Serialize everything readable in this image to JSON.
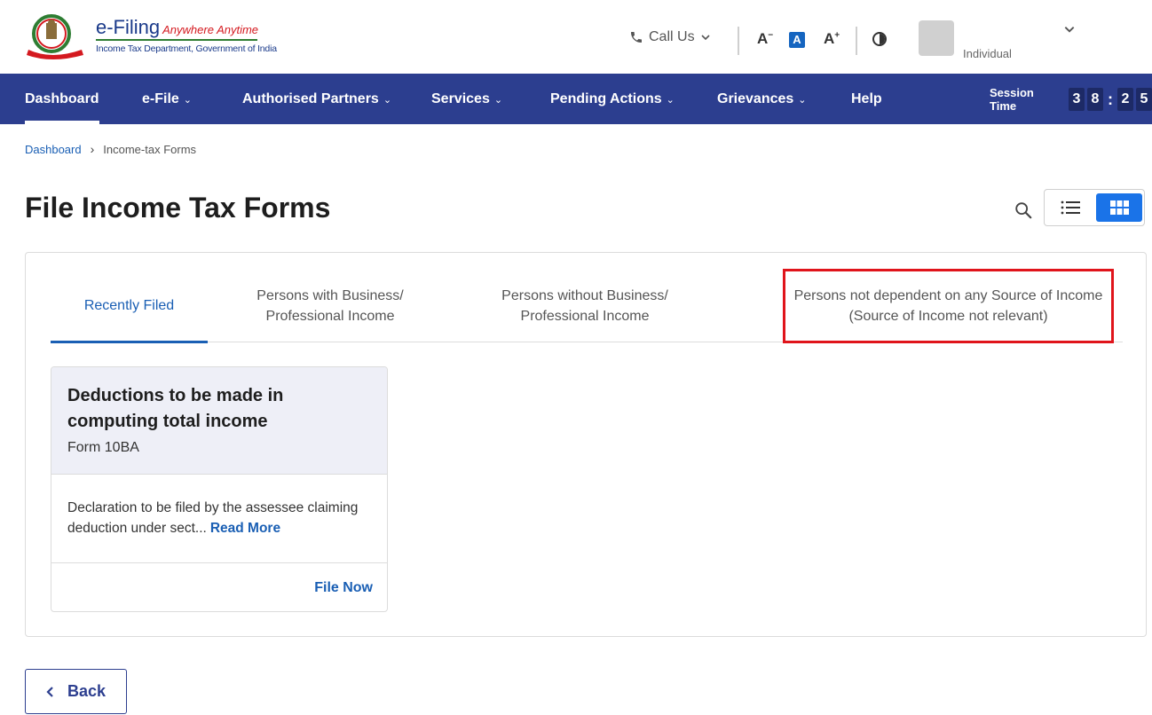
{
  "header": {
    "brand": "e-Filing",
    "tagline": "Anywhere Anytime",
    "department": "Income Tax Department, Government of India",
    "call_us": "Call Us",
    "font_decrease": "A",
    "font_normal": "A",
    "font_increase": "A",
    "user_type": "Individual"
  },
  "nav": {
    "items": [
      {
        "label": "Dashboard"
      },
      {
        "label": "e-File"
      },
      {
        "label": "Authorised Partners"
      },
      {
        "label": "Services"
      },
      {
        "label": "Pending Actions"
      },
      {
        "label": "Grievances"
      },
      {
        "label": "Help"
      }
    ],
    "session_label": "Session Time",
    "session_digits": [
      "3",
      "8",
      ":",
      "2",
      "5"
    ]
  },
  "breadcrumb": {
    "home": "Dashboard",
    "current": "Income-tax Forms"
  },
  "page": {
    "title": "File Income Tax Forms"
  },
  "tabs": [
    {
      "line1": "Recently Filed",
      "line2": ""
    },
    {
      "line1": "Persons with Business/",
      "line2": "Professional Income"
    },
    {
      "line1": "Persons without Business/",
      "line2": "Professional Income"
    },
    {
      "line1": "Persons not dependent on any Source of Income",
      "line2": "(Source of Income not relevant)"
    }
  ],
  "card": {
    "title": "Deductions to be made in computing total income",
    "form": "Form 10BA",
    "description": "Declaration to be filed by the assessee claiming deduction under sect...",
    "read_more": "Read More",
    "file_now": "File Now"
  },
  "back_label": "Back",
  "colors": {
    "nav_bg": "#2c3e8f",
    "accent": "#1a5fb4",
    "highlight": "#e0141b",
    "card_head": "#eeeff7"
  }
}
